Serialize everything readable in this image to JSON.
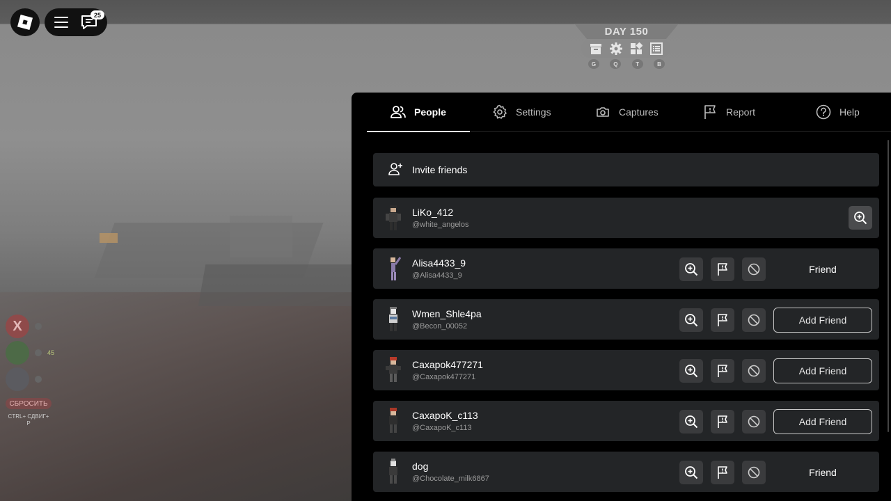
{
  "topbar": {
    "chat_badge": "25"
  },
  "hud": {
    "day": "DAY 150",
    "keys": [
      "G",
      "Q",
      "T",
      "B"
    ]
  },
  "side_hud": {
    "x_label": "X",
    "value_2": "45",
    "reset_label": "СБРОСИТЬ",
    "reset_keys": "CTRL+ СДВИГ+ P"
  },
  "panel": {
    "tabs": [
      {
        "label": "People",
        "icon": "people-icon",
        "active": true
      },
      {
        "label": "Settings",
        "icon": "gear-icon",
        "active": false
      },
      {
        "label": "Captures",
        "icon": "camera-icon",
        "active": false
      },
      {
        "label": "Report",
        "icon": "flag-icon",
        "active": false
      },
      {
        "label": "Help",
        "icon": "help-icon",
        "active": false
      }
    ],
    "invite_label": "Invite friends",
    "players": [
      {
        "display": "LiKo_412",
        "user": "@white_angelos",
        "status": "self"
      },
      {
        "display": "Alisa4433_9",
        "user": "@Alisa4433_9",
        "status": "Friend"
      },
      {
        "display": "Wmen_Shle4pa",
        "user": "@Becon_00052",
        "status": "Add Friend"
      },
      {
        "display": "Caxapok477271",
        "user": "@Caxapok477271",
        "status": "Add Friend"
      },
      {
        "display": "CaxapoK_c113",
        "user": "@CaxapoK_c113",
        "status": "Add Friend"
      },
      {
        "display": "dog",
        "user": "@Chocolate_milk6867",
        "status": "Friend"
      }
    ]
  }
}
